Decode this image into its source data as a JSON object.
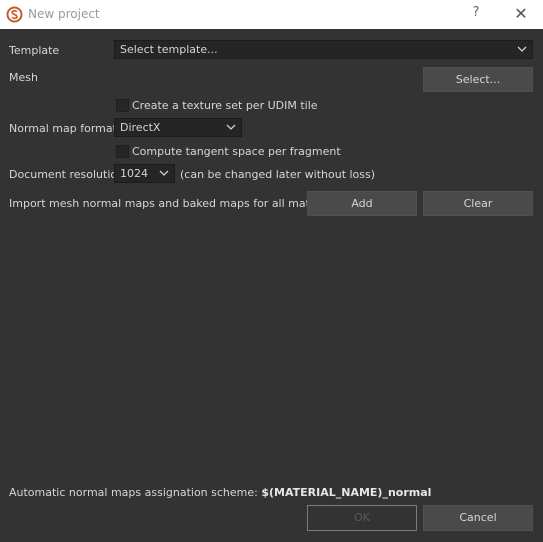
{
  "window": {
    "title": "New project",
    "help": "?",
    "close": "✕"
  },
  "template": {
    "label": "Template",
    "value": "Select template..."
  },
  "mesh": {
    "label": "Mesh",
    "button": "Select..."
  },
  "udim": {
    "label": "Create a texture set per UDIM tile",
    "checked": false
  },
  "normal_map_format": {
    "label": "Normal map format",
    "value": "DirectX"
  },
  "tangent": {
    "label": "Compute tangent space per fragment",
    "checked": false
  },
  "resolution": {
    "label": "Document resolution",
    "value": "1024",
    "note": "(can be changed later without loss)"
  },
  "import": {
    "label": "Import mesh normal maps and baked maps for all materials.",
    "add": "Add",
    "clear": "Clear"
  },
  "scheme": {
    "label": "Automatic normal maps assignation scheme:",
    "value": "$(MATERIAL_NAME)_normal"
  },
  "footer": {
    "ok": "OK",
    "cancel": "Cancel"
  },
  "icons": {
    "app": "substance-painter-icon",
    "dropdown": "chevron-down-icon"
  },
  "colors": {
    "background": "#333333",
    "titlebar": "#ffffff",
    "accent": "#c75a2a"
  }
}
